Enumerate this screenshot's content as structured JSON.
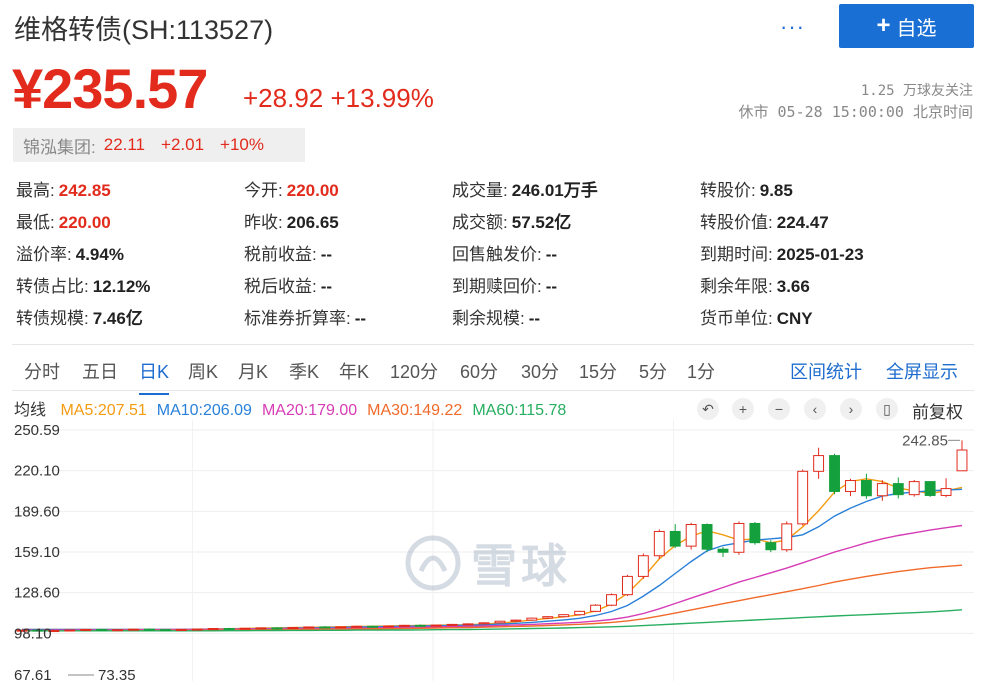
{
  "header": {
    "title": "维格转债(SH:113527)",
    "more_label": "···",
    "add_label": "自选",
    "price": "¥235.57",
    "change": "+28.92 +13.99%",
    "followers": "1.25 万球友关注",
    "status": "休市 05-28 15:00:00 北京时间"
  },
  "underlying": {
    "name": "锦泓集团:",
    "price": "22.11",
    "change": "+2.01",
    "pct": "+10%"
  },
  "quote": {
    "col1": [
      {
        "k": "最高:",
        "v": "242.85",
        "red": true
      },
      {
        "k": "最低:",
        "v": "220.00",
        "red": true
      },
      {
        "k": "溢价率:",
        "v": "4.94%"
      },
      {
        "k": "转债占比:",
        "v": "12.12%"
      },
      {
        "k": "转债规模:",
        "v": "7.46亿"
      }
    ],
    "col2": [
      {
        "k": "今开:",
        "v": "220.00",
        "red": true
      },
      {
        "k": "昨收:",
        "v": "206.65"
      },
      {
        "k": "税前收益:",
        "v": "--"
      },
      {
        "k": "税后收益:",
        "v": "--"
      },
      {
        "k": "标准券折算率:",
        "v": "--"
      }
    ],
    "col3": [
      {
        "k": "成交量:",
        "v": "246.01万手"
      },
      {
        "k": "成交额:",
        "v": "57.52亿"
      },
      {
        "k": "回售触发价:",
        "v": "--"
      },
      {
        "k": "到期赎回价:",
        "v": "--"
      },
      {
        "k": "剩余规模:",
        "v": "--"
      }
    ],
    "col4": [
      {
        "k": "转股价:",
        "v": "9.85"
      },
      {
        "k": "转股价值:",
        "v": "224.47"
      },
      {
        "k": "到期时间:",
        "v": "2025-01-23"
      },
      {
        "k": "剩余年限:",
        "v": "3.66"
      },
      {
        "k": "货币单位:",
        "v": "CNY"
      }
    ]
  },
  "tabs": [
    "分时",
    "五日",
    "日K",
    "周K",
    "月K",
    "季K",
    "年K",
    "120分",
    "60分",
    "30分",
    "15分",
    "5分",
    "1分"
  ],
  "active_tab": "日K",
  "tab_links": [
    "区间统计",
    "全屏显示"
  ],
  "ma": {
    "label": "均线",
    "items": [
      {
        "text": "MA5:207.51",
        "color": "#f39c12"
      },
      {
        "text": "MA10:206.09",
        "color": "#2980d9"
      },
      {
        "text": "MA20:179.00",
        "color": "#d63cb6"
      },
      {
        "text": "MA30:149.22",
        "color": "#f06a2a"
      },
      {
        "text": "MA60:115.78",
        "color": "#27ae60"
      }
    ]
  },
  "chart_controls": {
    "icons": [
      "undo-icon",
      "zoom-in-icon",
      "zoom-out-icon",
      "prev-icon",
      "next-icon",
      "candle-icon"
    ],
    "adjust_label": "前复权"
  },
  "watermark": "雪球",
  "chart_data": {
    "type": "candlestick",
    "y_ticks": [
      "250.59",
      "220.10",
      "189.60",
      "159.10",
      "128.60",
      "98.10"
    ],
    "high_label": "242.85",
    "low_label": "67.61",
    "low_label2": "73.35",
    "ylim": [
      67.61,
      250.59
    ],
    "candles": [
      [
        100,
        101,
        99,
        100.5
      ],
      [
        100.5,
        101,
        99.5,
        100
      ],
      [
        100,
        100.8,
        99.4,
        100.2
      ],
      [
        100.2,
        101,
        99.8,
        100.6
      ],
      [
        100.6,
        101.5,
        100,
        101
      ],
      [
        101,
        101.5,
        100.2,
        100.4
      ],
      [
        100.4,
        101,
        99.8,
        100.8
      ],
      [
        100.8,
        101.6,
        100.3,
        101.2
      ],
      [
        101.2,
        101.8,
        100.6,
        100.9
      ],
      [
        100.9,
        101.3,
        100.1,
        100.5
      ],
      [
        100.5,
        101.2,
        100,
        101
      ],
      [
        101,
        101.5,
        100.5,
        101.3
      ],
      [
        101.3,
        102,
        100.9,
        101.7
      ],
      [
        101.7,
        102.3,
        101.2,
        101.5
      ],
      [
        101.5,
        102,
        101,
        101.9
      ],
      [
        101.9,
        102.5,
        101.5,
        102.2
      ],
      [
        102.2,
        102.8,
        101.8,
        102
      ],
      [
        102,
        102.7,
        101.5,
        102.5
      ],
      [
        102.5,
        103.2,
        102,
        102.9
      ],
      [
        102.9,
        103.5,
        102.3,
        102.6
      ],
      [
        102.6,
        103.2,
        102,
        103
      ],
      [
        103,
        103.8,
        102.6,
        103.4
      ],
      [
        103.4,
        104,
        102.9,
        103.1
      ],
      [
        103.1,
        103.9,
        102.7,
        103.6
      ],
      [
        103.6,
        104.5,
        103.2,
        104.1
      ],
      [
        104.1,
        104.8,
        103.5,
        103.8
      ],
      [
        103.8,
        104.6,
        103.3,
        104.3
      ],
      [
        104.3,
        105.2,
        103.9,
        104.8
      ],
      [
        104.8,
        105.6,
        104.3,
        105.2
      ],
      [
        105.2,
        106.4,
        104.8,
        106
      ],
      [
        106,
        107.5,
        105.6,
        107.2
      ],
      [
        107.2,
        108.5,
        106.8,
        108
      ],
      [
        108,
        110,
        107.5,
        109.5
      ],
      [
        109.5,
        111,
        108.8,
        110.6
      ],
      [
        110.6,
        112.5,
        110,
        112.1
      ],
      [
        112.1,
        115,
        111.5,
        114.6
      ],
      [
        114.6,
        120,
        114,
        119.2
      ],
      [
        119.2,
        128,
        118.5,
        127.1
      ],
      [
        127.1,
        142,
        126,
        140.8
      ],
      [
        140.8,
        158,
        139,
        156.3
      ],
      [
        156.3,
        176,
        154,
        174.5
      ],
      [
        174.5,
        180,
        162,
        163.5
      ],
      [
        163.5,
        181,
        161,
        179.7
      ],
      [
        179.7,
        180.5,
        159,
        161.2
      ],
      [
        161.2,
        162.8,
        155.4,
        158.9
      ],
      [
        158.9,
        182,
        157,
        180.5
      ],
      [
        180.5,
        181.6,
        164.6,
        166.1
      ],
      [
        166.1,
        168,
        159,
        160.8
      ],
      [
        160.8,
        182,
        159.3,
        180.2
      ],
      [
        180.2,
        221,
        179,
        219.6
      ],
      [
        219.6,
        237.3,
        214,
        231.4
      ],
      [
        231.4,
        232.8,
        202.4,
        204.5
      ],
      [
        204.5,
        214,
        201,
        212.7
      ],
      [
        212.7,
        217.8,
        199,
        201.3
      ],
      [
        201.3,
        213,
        197.5,
        210.4
      ],
      [
        210.4,
        215,
        199.3,
        202.1
      ],
      [
        202.1,
        213.1,
        200.6,
        211.9
      ],
      [
        211.9,
        212.2,
        200.4,
        201.5
      ],
      [
        201.5,
        214.4,
        200.1,
        206.65
      ],
      [
        220,
        242.85,
        220,
        235.57
      ]
    ],
    "ma5": [
      101,
      101,
      101,
      101,
      101,
      101,
      101,
      101,
      101,
      101,
      101,
      101.2,
      101.4,
      101.6,
      101.8,
      102,
      102.2,
      102.4,
      102.6,
      102.8,
      103,
      103.2,
      103.4,
      103.6,
      103.8,
      104,
      104.2,
      104.4,
      104.6,
      105,
      105.8,
      106.8,
      108,
      109.3,
      110.5,
      112,
      115,
      120,
      128,
      140,
      154,
      164,
      171,
      175,
      172,
      168,
      169,
      166,
      168,
      178,
      190,
      204,
      212,
      214,
      212,
      207,
      205,
      203,
      205,
      207.51
    ],
    "ma10": [
      101,
      101,
      101,
      101,
      101,
      101,
      101,
      101,
      101,
      101,
      101,
      101.1,
      101.2,
      101.3,
      101.4,
      101.6,
      101.8,
      102,
      102.2,
      102.4,
      102.6,
      102.8,
      103,
      103.2,
      103.4,
      103.6,
      103.8,
      104,
      104.2,
      104.5,
      105,
      105.6,
      106.3,
      107.2,
      108.2,
      109.4,
      111.5,
      114.5,
      119,
      126,
      134,
      143,
      152,
      160,
      164,
      166,
      168,
      169,
      170,
      172,
      178,
      186,
      192,
      197,
      201,
      203,
      204,
      205,
      205.5,
      206.09
    ],
    "ma20": [
      100.5,
      100.5,
      100.5,
      100.6,
      100.6,
      100.7,
      100.7,
      100.8,
      100.8,
      100.9,
      101,
      101,
      101.1,
      101.2,
      101.3,
      101.4,
      101.5,
      101.6,
      101.7,
      101.8,
      101.9,
      102,
      102.2,
      102.4,
      102.6,
      102.8,
      103,
      103.2,
      103.4,
      103.6,
      104,
      104.4,
      104.8,
      105.3,
      105.8,
      106.4,
      107.3,
      108.5,
      110.3,
      113,
      116.5,
      120.5,
      124.5,
      128.5,
      132.5,
      136.5,
      140,
      143.5,
      147,
      151,
      155,
      159,
      162.5,
      166,
      169,
      171.5,
      173.5,
      175.5,
      177.3,
      179.0
    ],
    "ma30": [
      100,
      100,
      100,
      100,
      100.1,
      100.1,
      100.2,
      100.2,
      100.3,
      100.3,
      100.4,
      100.4,
      100.5,
      100.6,
      100.7,
      100.8,
      100.9,
      101,
      101.1,
      101.2,
      101.3,
      101.4,
      101.5,
      101.6,
      101.7,
      101.9,
      102.1,
      102.3,
      102.5,
      102.7,
      103,
      103.3,
      103.6,
      104,
      104.4,
      104.9,
      105.5,
      106.3,
      107.4,
      109,
      111,
      113.3,
      115.7,
      118,
      120.3,
      122.6,
      124.9,
      127.1,
      129.3,
      131.6,
      134,
      136.5,
      138.7,
      140.8,
      142.7,
      144.4,
      145.9,
      147.3,
      148.3,
      149.22
    ],
    "ma60": [
      100,
      100,
      100,
      100,
      100,
      100,
      100,
      100,
      100,
      100,
      100,
      100,
      100,
      100.1,
      100.1,
      100.2,
      100.2,
      100.3,
      100.3,
      100.4,
      100.4,
      100.5,
      100.5,
      100.6,
      100.6,
      100.7,
      100.8,
      100.9,
      101,
      101.1,
      101.3,
      101.5,
      101.7,
      101.9,
      102.1,
      102.4,
      102.7,
      103,
      103.4,
      103.9,
      104.5,
      105.1,
      105.7,
      106.3,
      106.9,
      107.5,
      108.1,
      108.7,
      109.3,
      109.9,
      110.5,
      111.1,
      111.6,
      112.1,
      112.6,
      113.1,
      113.6,
      114.2,
      114.9,
      115.78
    ]
  }
}
